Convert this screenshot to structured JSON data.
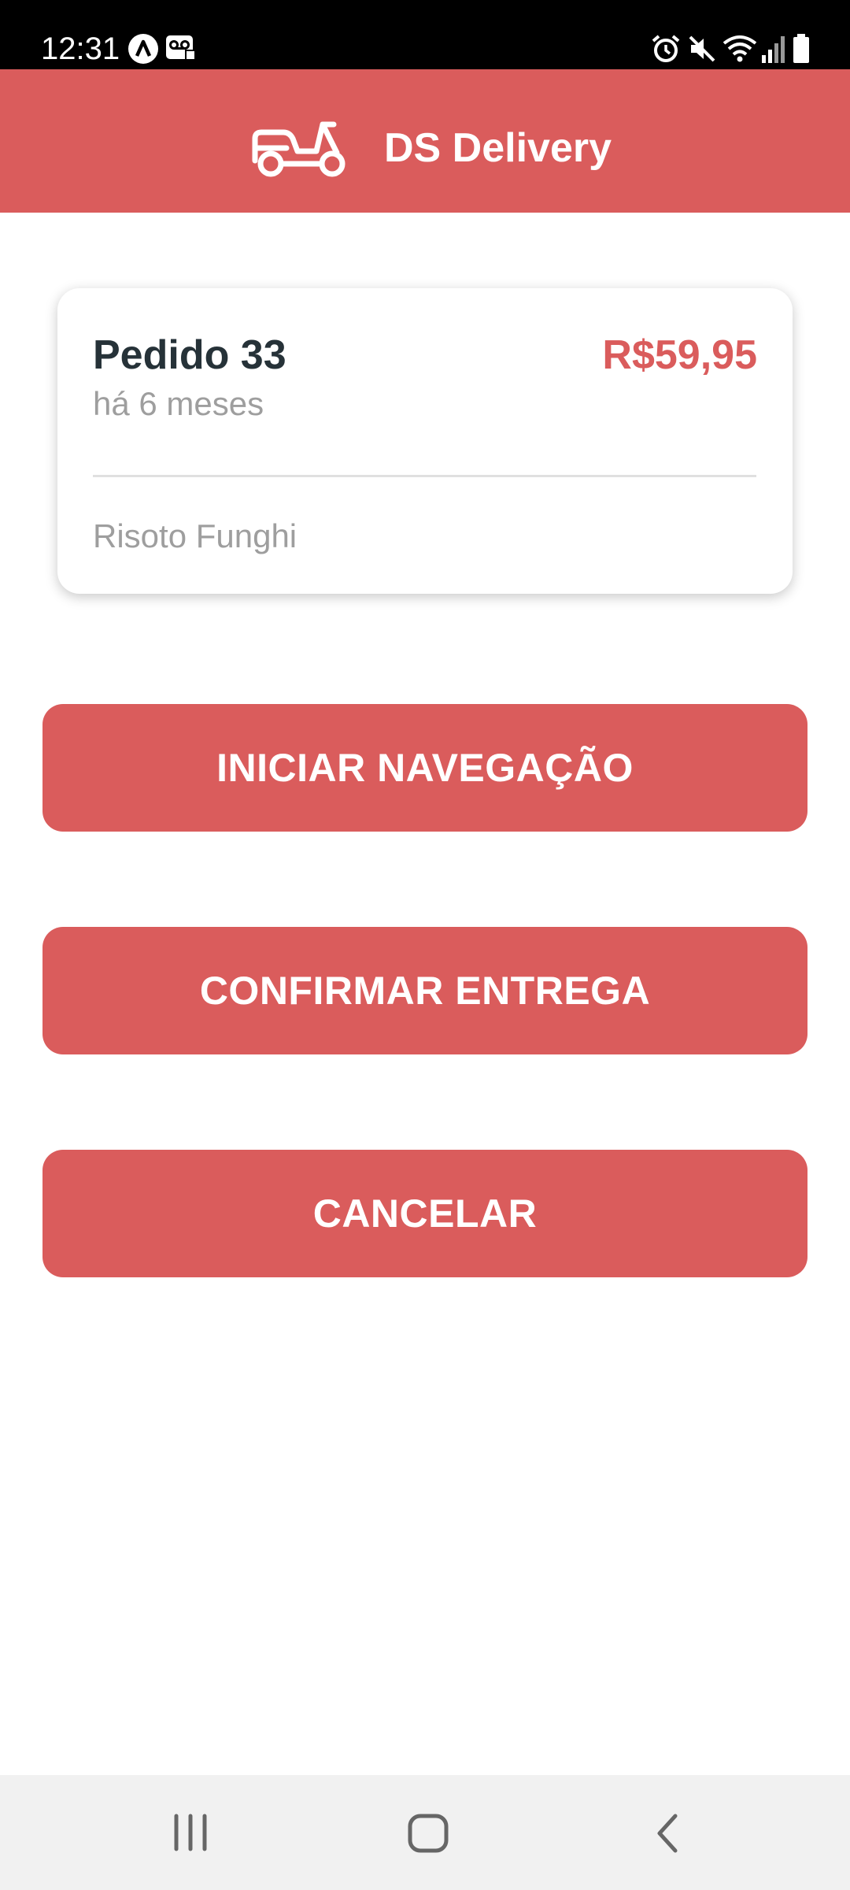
{
  "status_bar": {
    "time": "12:31",
    "left_icons": [
      "a-notification-icon",
      "voicemail-icon"
    ],
    "right_icons": [
      "alarm-icon",
      "mute-icon",
      "wifi-icon",
      "signal-icon",
      "battery-icon"
    ]
  },
  "header": {
    "title": "DS Delivery",
    "logo_icon": "motorcycle-icon"
  },
  "order": {
    "title": "Pedido 33",
    "price": "R$59,95",
    "time_ago": "há 6 meses",
    "products": "Risoto Funghi"
  },
  "buttons": {
    "start_navigation": "INICIAR NAVEGAÇÃO",
    "confirm_delivery": "CONFIRMAR ENTREGA",
    "cancel": "CANCELAR"
  },
  "nav_bar": {
    "items": [
      "recent-apps-icon",
      "home-icon",
      "back-icon"
    ]
  },
  "colors": {
    "primary": "#da5c5c",
    "text_dark": "#263238",
    "text_muted": "#9e9e9e"
  }
}
